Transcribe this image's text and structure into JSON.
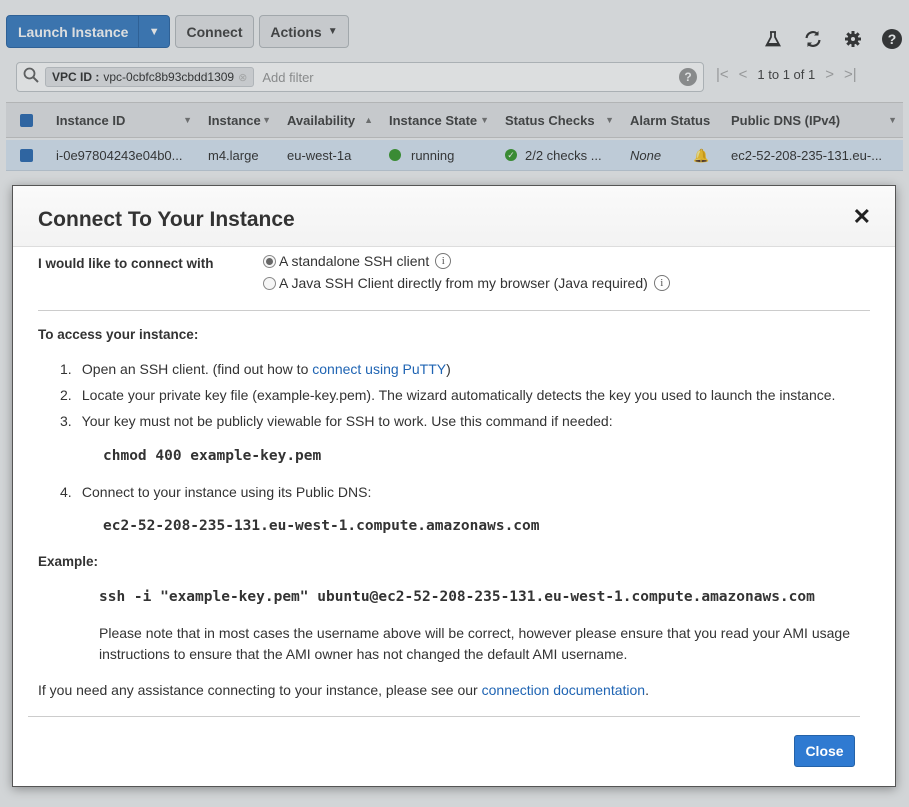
{
  "toolbar": {
    "launch_label": "Launch Instance",
    "connect_label": "Connect",
    "actions_label": "Actions"
  },
  "filter": {
    "vpc_key": "VPC ID :",
    "vpc_value": "vpc-0cbfc8b93cbdd1309",
    "placeholder": "Add filter",
    "pager_text": "1 to 1 of 1"
  },
  "table": {
    "columns": [
      "Instance ID",
      "Instance",
      "Availability",
      "Instance State",
      "Status Checks",
      "Alarm Status",
      "Public DNS (IPv4)"
    ],
    "rows": [
      {
        "instance_id": "i-0e97804243e04b0...",
        "type": "m4.large",
        "az": "eu-west-1a",
        "state": "running",
        "status_checks": "2/2 checks ...",
        "alarm": "None",
        "dns": "ec2-52-208-235-131.eu-..."
      }
    ]
  },
  "modal": {
    "title": "Connect To Your Instance",
    "close_glyph": "✕",
    "connect_with_label": "I would like to connect with",
    "option1": "A standalone SSH client",
    "option2": "A Java SSH Client directly from my browser (Java required)",
    "access_title": "To access your instance:",
    "step1_num": "1.",
    "step1_text": "Open an SSH client. (find out how to",
    "step1_link": "connect using PuTTY",
    "step1_end": ")",
    "step2_num": "2.",
    "step2_text": "Locate your private key file (example-key.pem). The wizard automatically detects the key you used to launch the instance.",
    "step3_num": "3.",
    "step3_text": "Your key must not be publicly viewable for SSH to work. Use this command if needed:",
    "chmod_cmd": "chmod 400 example-key.pem",
    "step4_num": "4.",
    "step4_text": "Connect to your instance using its Public DNS:",
    "public_dns": "ec2-52-208-235-131.eu-west-1.compute.amazonaws.com",
    "example_title": "Example:",
    "ssh_cmd": "ssh -i \"example-key.pem\" ubuntu@ec2-52-208-235-131.eu-west-1.compute.amazonaws.com",
    "note": "Please note that in most cases the username above will be correct, however please ensure that you read your AMI usage instructions to ensure that the AMI owner has not changed the default AMI username.",
    "assist_text": "If you need any assistance connecting to your instance, please see our",
    "assist_link": "connection documentation",
    "assist_end": ".",
    "close_button": "Close"
  }
}
